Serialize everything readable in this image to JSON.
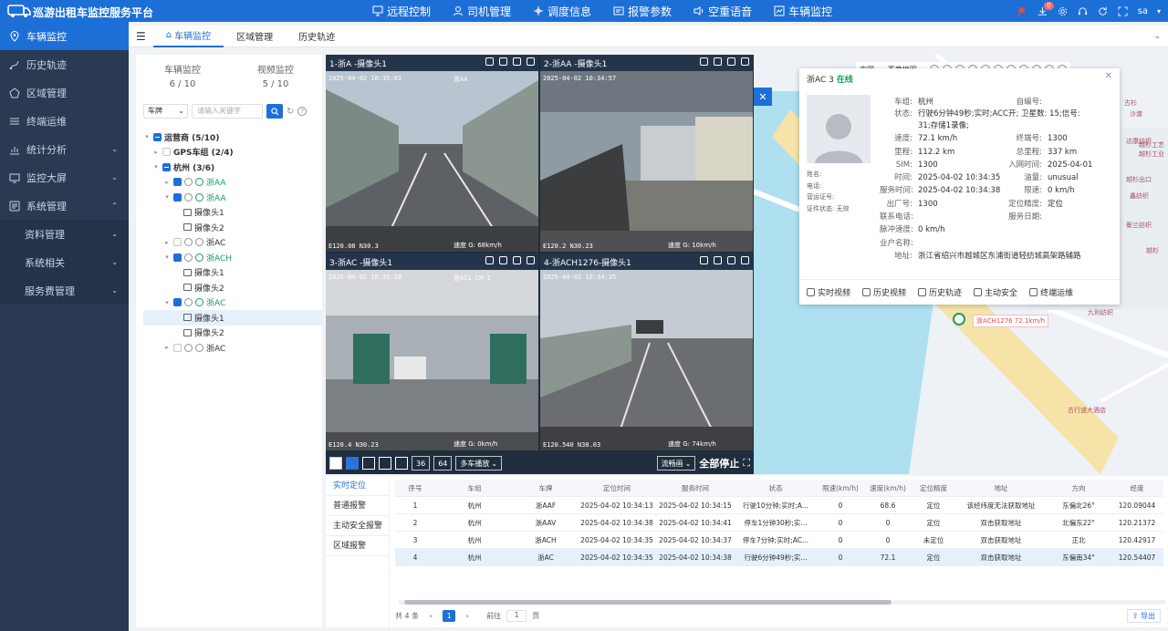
{
  "header": {
    "title": "巡游出租车监控服务平台",
    "nav": [
      "远程控制",
      "司机管理",
      "调度信息",
      "报警参数",
      "空重语音",
      "车辆监控"
    ],
    "notify_count": "0",
    "user": "sa"
  },
  "sidebar": {
    "items": [
      {
        "label": "车辆监控",
        "active": true
      },
      {
        "label": "历史轨迹"
      },
      {
        "label": "区域管理"
      },
      {
        "label": "终端运维"
      },
      {
        "label": "统计分析",
        "arrow": "down"
      },
      {
        "label": "监控大屏",
        "arrow": "down"
      },
      {
        "label": "系统管理",
        "arrow": "up"
      }
    ],
    "subitems": [
      {
        "label": "资料管理",
        "arrow": "down"
      },
      {
        "label": "系统相关",
        "arrow": "down"
      },
      {
        "label": "服务费管理",
        "arrow": "down"
      }
    ]
  },
  "tabs": [
    "车辆监控",
    "区域管理",
    "历史轨迹"
  ],
  "tree_panel": {
    "stats": [
      {
        "label": "车辆监控",
        "value": "6 / 10"
      },
      {
        "label": "视频监控",
        "value": "5 / 10"
      }
    ],
    "filter_select": "车牌",
    "search_placeholder": "请输入关键字",
    "nodes": [
      {
        "level": 0,
        "label": "运营商 (5/10)",
        "bold": true
      },
      {
        "level": 1,
        "label": "GPS车组 (2/4)",
        "bold": true
      },
      {
        "level": 1,
        "label": "杭州 (3/6)",
        "bold": true
      },
      {
        "level": 2,
        "label": "浙AA",
        "green": true
      },
      {
        "level": 2,
        "label": "浙AA",
        "green": true
      },
      {
        "level": 3,
        "label": "摄像头1"
      },
      {
        "level": 3,
        "label": "摄像头2"
      },
      {
        "level": 2,
        "label": "浙AC"
      },
      {
        "level": 2,
        "label": "浙ACH",
        "green": true
      },
      {
        "level": 3,
        "label": "摄像头1"
      },
      {
        "level": 3,
        "label": "摄像头2"
      },
      {
        "level": 2,
        "label": "浙AC",
        "green": true
      },
      {
        "level": 3,
        "label": "摄像头1",
        "selected": true
      },
      {
        "level": 3,
        "label": "摄像头2"
      },
      {
        "level": 2,
        "label": "浙AC"
      }
    ]
  },
  "video": {
    "cells": [
      {
        "title": "1-浙A        -摄像头1",
        "time": "2025-04-02 10:35:01",
        "plate": "浙AA",
        "coords": "E120.08    N30.3    ",
        "speed": "速度 G: 68km/h"
      },
      {
        "title": "2-浙AA       -摄像头1",
        "time": "2025-04-02 10:34:57",
        "plate": "",
        "coords": "E120.2     N30.23   ",
        "speed": "速度 G: 10km/h"
      },
      {
        "title": "3-浙AC       -摄像头1",
        "time": "2025-04-02 10:35:18",
        "plate": "浙AC1   CH-1",
        "coords": "E120.4     N30.23   ",
        "speed": "速度 G:  0km/h"
      },
      {
        "title": "4-浙ACH1276-摄像头1",
        "time": "2025-04-02 10:34:35",
        "plate": "",
        "coords": "E120.540   N30.03   ",
        "speed": "速度 G: 74km/h"
      }
    ],
    "layout_sizes": [
      "36",
      "64"
    ],
    "mode": "多车播放",
    "stream": "流畅画",
    "stop_all": "全部停止"
  },
  "map": {
    "lang": "中国",
    "map_type": "百度地图",
    "labels": [
      "古杉",
      "沙渡",
      "达康纺织",
      "九利纺织",
      "越杉工艺",
      "越杉工业",
      "越杉出口",
      "衡兰纺织",
      "鑫纺织",
      "越杉",
      "杭新",
      "古行道大酒店"
    ],
    "car_label": "浙ACH1276 72.1km/h",
    "popup": {
      "title": "浙AC    3",
      "status": "在线",
      "left_labels": [
        "姓名:",
        "电话:",
        "营运证号:",
        "证件状态: 无效"
      ],
      "rows": [
        [
          "车组:",
          "杭州",
          "自编号:",
          ""
        ],
        [
          "状态:",
          "行驶6分钟49秒;实时;ACC开; 卫星数: 15;信号: 31;存储1录像;",
          "",
          ""
        ],
        [
          "速度:",
          "72.1 km/h",
          "终端号:",
          "1300"
        ],
        [
          "里程:",
          "112.2 km",
          "总里程:",
          "337 km"
        ],
        [
          "SIM:",
          "1300",
          "入网时间:",
          "2025-04-01"
        ],
        [
          "时间:",
          "2025-04-02 10:34:35",
          "油量:",
          "unusual"
        ],
        [
          "服务时间:",
          "2025-04-02 10:34:38",
          "限速:",
          "0 km/h"
        ],
        [
          "出厂号:",
          "1300",
          "定位精度:",
          "定位"
        ],
        [
          "联系电话:",
          "",
          "服务日期:",
          ""
        ],
        [
          "脉冲速度:",
          "0 km/h",
          "",
          ""
        ],
        [
          "业户名称:",
          "",
          "",
          ""
        ],
        [
          "地址:",
          "浙江省绍兴市越城区东浦街道轻纺城高架路辅路",
          "",
          ""
        ]
      ],
      "actions": [
        "实时视频",
        "历史视频",
        "历史轨迹",
        "主动安全",
        "终端运维"
      ]
    }
  },
  "bottom": {
    "side_tabs": [
      "实时定位",
      "普通报警",
      "主动安全报警",
      "区域报警"
    ],
    "columns": [
      "序号",
      "车组",
      "车牌",
      "定位时间",
      "服务时间",
      "状态",
      "限速(km/h)",
      "速度(km/h)",
      "定位精度",
      "地址",
      "方向",
      "经度"
    ],
    "rows": [
      [
        "1",
        "杭州",
        "浙AAF",
        "2025-04-02 10:34:13",
        "2025-04-02 10:34:15",
        "行驶10分钟;实时;A...",
        "0",
        "68.6",
        "定位",
        "该经纬度无法获取地址",
        "东偏北26°",
        "120.09044"
      ],
      [
        "2",
        "杭州",
        "浙AAV",
        "2025-04-02 10:34:38",
        "2025-04-02 10:34:41",
        "停车1分钟30秒;实...",
        "0",
        "0",
        "定位",
        "双击获取地址",
        "北偏东22°",
        "120.21372"
      ],
      [
        "3",
        "杭州",
        "浙ACH",
        "2025-04-02 10:34:35",
        "2025-04-02 10:34:37",
        "停车7分钟;实时;AC...",
        "0",
        "0",
        "未定位",
        "双击获取地址",
        "正北",
        "120.42917"
      ],
      [
        "4",
        "杭州",
        "浙AC",
        "2025-04-02 10:34:35",
        "2025-04-02 10:34:38",
        "行驶6分钟49秒;实...",
        "0",
        "72.1",
        "定位",
        "双击获取地址",
        "东偏南34°",
        "120.54407"
      ]
    ],
    "pager": {
      "total": "共 4 条",
      "page": "1",
      "goto": "前往",
      "goto_val": "1",
      "page_suffix": "页"
    },
    "export": "导出"
  },
  "colors": {
    "primary": "#1d6fd8",
    "sidebar": "#2a3a52",
    "online": "#18a058"
  }
}
